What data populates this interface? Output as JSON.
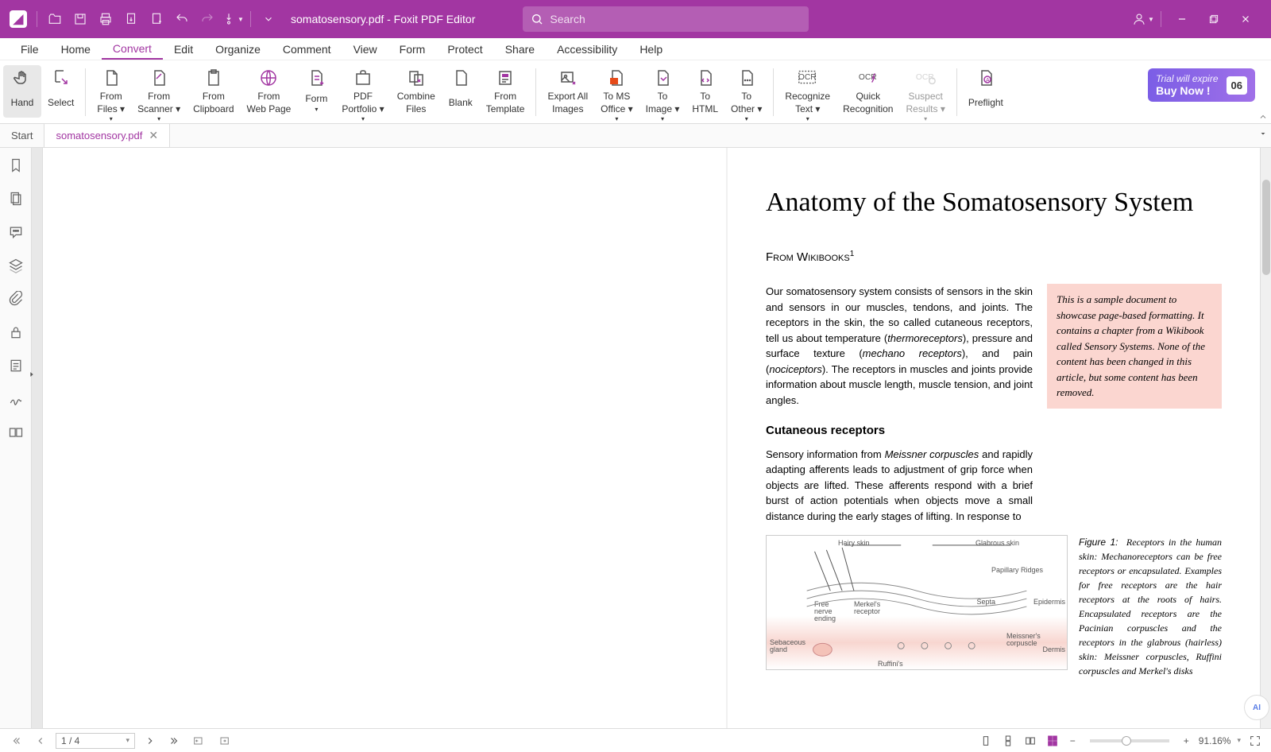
{
  "title_bar": {
    "doc_title": "somatosensory.pdf - Foxit PDF Editor",
    "search_placeholder": "Search"
  },
  "menus": [
    "File",
    "Home",
    "Convert",
    "Edit",
    "Organize",
    "Comment",
    "View",
    "Form",
    "Protect",
    "Share",
    "Accessibility",
    "Help"
  ],
  "menu_active": "Convert",
  "ribbon": {
    "hand": "Hand",
    "select": "Select",
    "from_files": "From\nFiles",
    "from_scanner": "From\nScanner",
    "from_clipboard": "From\nClipboard",
    "from_webpage": "From\nWeb Page",
    "form": "Form",
    "pdf_portfolio": "PDF\nPortfolio",
    "combine_files": "Combine\nFiles",
    "blank": "Blank",
    "from_template": "From\nTemplate",
    "export_all_images": "Export All\nImages",
    "to_ms_office": "To MS\nOffice",
    "to_image": "To\nImage",
    "to_html": "To\nHTML",
    "to_other": "To\nOther",
    "recognize_text": "Recognize\nText",
    "quick_recognition": "Quick\nRecognition",
    "suspect_results": "Suspect\nResults",
    "preflight": "Preflight"
  },
  "trial": {
    "line1": "Trial will expire",
    "line2": "Buy Now !",
    "days": "06"
  },
  "tabs": {
    "start": "Start",
    "doc": "somatosensory.pdf"
  },
  "document": {
    "heading": "Anatomy of the Somatosensory System",
    "source": "From Wikibooks",
    "p1": "Our somatosensory system consists of sensors in the skin and sensors in our muscles, tendons, and joints. The receptors in the skin, the so called cutaneous receptors, tell us about temperature (thermoreceptors), pressure and surface texture (mechano receptors), and pain (nociceptors). The receptors in muscles and joints provide information about muscle length, muscle tension, and joint angles.",
    "callout": "This is a sample document to showcase page-based formatting. It contains a chapter from a Wikibook called Sensory Systems. None of the content has been changed in this article, but some content has been removed.",
    "h2": "Cutaneous receptors",
    "p2": "Sensory information from Meissner corpuscles and rapidly adapting afferents leads to adjustment of grip force when objects are lifted. These afferents respond with a brief burst of action potentials when objects move a small distance during the early stages of lifting. In response to",
    "fig_labels": {
      "hairy": "Hairy skin",
      "glabrous": "Glabrous skin",
      "papillary": "Papillary Ridges",
      "epidermis": "Epidermis",
      "dermis": "Dermis",
      "septa": "Septa",
      "freenerve": "Free nerve ending",
      "merkel": "Merkel's receptor",
      "meissner": "Meissner's corpuscle",
      "sebaceous": "Sebaceous gland",
      "ruffini": "Ruffini's"
    },
    "fig_caption": "Figure 1:  Receptors in the human skin: Mechanoreceptors can be free receptors or encapsulated. Examples for free receptors are the hair receptors at the roots of hairs. Encapsulated receptors are the Pacinian corpuscles and the receptors in the glabrous (hairless) skin: Meissner corpuscles, Ruffini corpuscles and Merkel's disks"
  },
  "status": {
    "page": "1 / 4",
    "zoom": "91.16%"
  }
}
